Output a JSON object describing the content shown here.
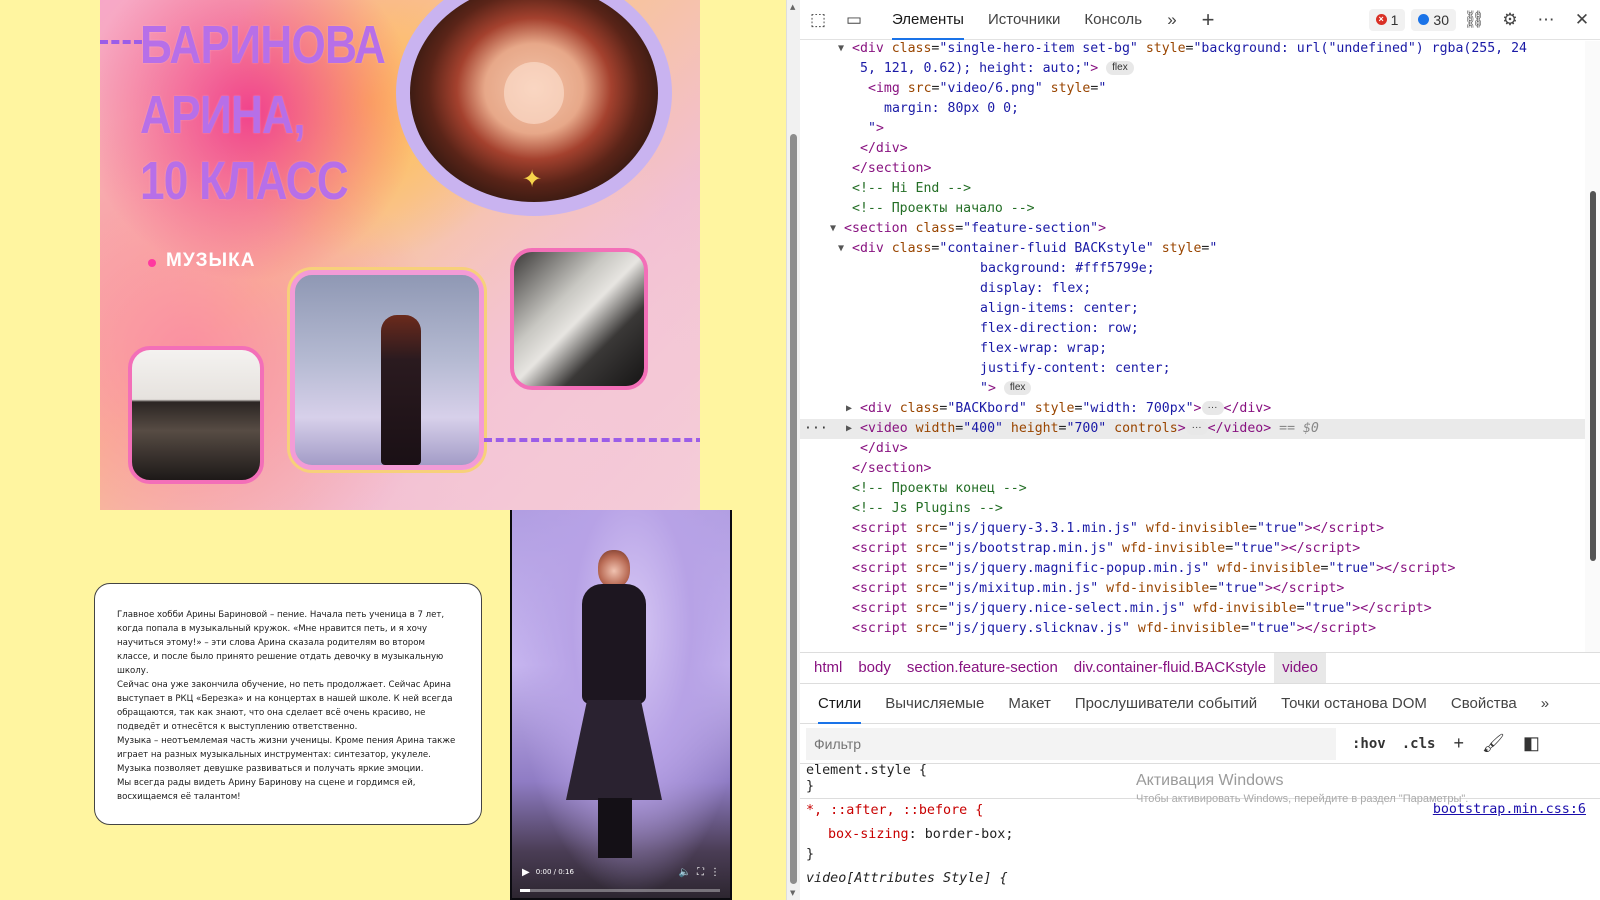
{
  "page": {
    "hero": {
      "name_lines": [
        "БАРИНОВА",
        "АРИНА,",
        "10 КЛАСС"
      ],
      "tag": "МУЗЫКА"
    },
    "bio": {
      "paragraphs": [
        "Главное хобби Арины Бариновой – пение. Начала петь ученица в 7 лет, когда попала в музыкальный кружок. «Мне нравится петь, и я хочу научиться этому!» – эти слова Арина сказала родителям во втором классе, и после было принято решение отдать девочку в музыкальную школу.",
        "Сейчас она уже закончила обучение, но петь продолжает. Сейчас Арина выступает в РКЦ «Березка» и на концертах в нашей школе. К ней всегда обращаются, так как знают, что она сделает всё очень красиво, не подведёт и отнесётся к выступлению ответственно.",
        "Музыка – неотъемлемая часть жизни ученицы. Кроме пения Арина также играет на разных музыкальных инструментах: синтезатор, укулеле. Музыка позволяет девушке развиваться и получать яркие эмоции.",
        "Мы всегда рады видеть Арину Баринову на сцене и гордимся ей, восхищаемся её талантом!"
      ]
    },
    "video": {
      "time": "0:00 / 0:16",
      "progress": 0.05,
      "play_icon": "play-icon",
      "volume_icon": "volume-icon",
      "fullscreen_icon": "fullscreen-icon",
      "more_icon": "more-vertical-icon"
    }
  },
  "devtools": {
    "tabs": [
      "Элементы",
      "Источники",
      "Консоль"
    ],
    "active_tab": "Элементы",
    "errors_count": "1",
    "messages_count": "30",
    "dom_lines": [
      {
        "indent": 4,
        "arrow": "▼",
        "html": "<span class='tg'>&lt;div</span> <span class='at'>class</span>=<span class='av'>\"single-hero-item set-bg\"</span> <span class='at'>style</span>=<span class='av'>\"background: url(\"undefined\") rgba(255, 24</span>"
      },
      {
        "indent": 5,
        "arrow": "",
        "html": "<span class='av'>5, 121, 0.62); height: auto;\"</span><span class='tg'>&gt;</span> <span class='pill'>flex</span>"
      },
      {
        "indent": 6,
        "arrow": "",
        "html": "<span class='tg'>&lt;img</span> <span class='at'>src</span>=<span class='av'>\"video/6.png\"</span> <span class='at'>style</span>=<span class='av'>\"</span>"
      },
      {
        "indent": 8,
        "arrow": "",
        "html": "<span class='av'>margin: 80px 0 0;</span>"
      },
      {
        "indent": 6,
        "arrow": "",
        "html": "<span class='av'>\"</span><span class='tg'>&gt;</span>"
      },
      {
        "indent": 5,
        "arrow": "",
        "html": "<span class='tg'>&lt;/div&gt;</span>"
      },
      {
        "indent": 4,
        "arrow": "",
        "html": "<span class='tg'>&lt;/section&gt;</span>"
      },
      {
        "indent": 4,
        "arrow": "",
        "html": "<span class='cm'>&lt;!-- Hi End --&gt;</span>"
      },
      {
        "indent": 4,
        "arrow": "",
        "html": "<span class='cm'>&lt;!-- Проекты начало --&gt;</span>"
      },
      {
        "indent": 3,
        "arrow": "▼",
        "html": "<span class='tg'>&lt;section</span> <span class='at'>class</span>=<span class='av'>\"feature-section\"</span><span class='tg'>&gt;</span>"
      },
      {
        "indent": 4,
        "arrow": "▼",
        "html": "<span class='tg'>&lt;div</span> <span class='at'>class</span>=<span class='av'>\"container-fluid BACKstyle\"</span> <span class='at'>style</span>=<span class='av'>\"</span>"
      },
      {
        "indent": 20,
        "arrow": "",
        "html": "<span class='av'>background: #fff5799e;</span>"
      },
      {
        "indent": 20,
        "arrow": "",
        "html": "<span class='av'>display: flex;</span>"
      },
      {
        "indent": 20,
        "arrow": "",
        "html": "<span class='av'>align-items: center;</span>"
      },
      {
        "indent": 20,
        "arrow": "",
        "html": "<span class='av'>flex-direction: row;</span>"
      },
      {
        "indent": 20,
        "arrow": "",
        "html": "<span class='av'>flex-wrap: wrap;</span>"
      },
      {
        "indent": 20,
        "arrow": "",
        "html": "<span class='av'>justify-content: center;</span>"
      },
      {
        "indent": 20,
        "arrow": "",
        "html": "<span class='av'>\"</span><span class='tg'>&gt;</span> <span class='pill'>flex</span>"
      },
      {
        "indent": 5,
        "arrow": "▶",
        "html": "<span class='tg'>&lt;div</span> <span class='at'>class</span>=<span class='av'>\"BACKbord\"</span> <span class='at'>style</span>=<span class='av'>\"width: 700px\"</span><span class='tg'>&gt;</span><span class='pill'>···</span><span class='tg'>&lt;/div&gt;</span>"
      },
      {
        "indent": 5,
        "arrow": "▶",
        "selected": true,
        "html": "<span class='tg'>&lt;video</span> <span class='at'>width</span>=<span class='av'>\"400\"</span> <span class='at'>height</span>=<span class='av'>\"700\"</span> <span class='at'>controls</span><span class='tg'>&gt;</span><span class='pill'>···</span><span class='tg'>&lt;/video&gt;</span> <span class='gray'>== $0</span>"
      },
      {
        "indent": 5,
        "arrow": "",
        "html": "<span class='tg'>&lt;/div&gt;</span>"
      },
      {
        "indent": 4,
        "arrow": "",
        "html": "<span class='tg'>&lt;/section&gt;</span>"
      },
      {
        "indent": 4,
        "arrow": "",
        "html": "<span class='cm'>&lt;!-- Проекты конец --&gt;</span>"
      },
      {
        "indent": 4,
        "arrow": "",
        "html": "<span class='cm'>&lt;!-- Js Plugins --&gt;</span>"
      },
      {
        "indent": 4,
        "arrow": "",
        "html": "<span class='tg'>&lt;script</span> <span class='at'>src</span>=<span class='av'>\"js/jquery-3.3.1.min.js\"</span> <span class='at'>wfd-invisible</span>=<span class='av'>\"true\"</span><span class='tg'>&gt;&lt;/script&gt;</span>"
      },
      {
        "indent": 4,
        "arrow": "",
        "html": "<span class='tg'>&lt;script</span> <span class='at'>src</span>=<span class='av'>\"js/bootstrap.min.js\"</span> <span class='at'>wfd-invisible</span>=<span class='av'>\"true\"</span><span class='tg'>&gt;&lt;/script&gt;</span>"
      },
      {
        "indent": 4,
        "arrow": "",
        "html": "<span class='tg'>&lt;script</span> <span class='at'>src</span>=<span class='av'>\"js/jquery.magnific-popup.min.js\"</span> <span class='at'>wfd-invisible</span>=<span class='av'>\"true\"</span><span class='tg'>&gt;&lt;/script&gt;</span>"
      },
      {
        "indent": 4,
        "arrow": "",
        "html": "<span class='tg'>&lt;script</span> <span class='at'>src</span>=<span class='av'>\"js/mixitup.min.js\"</span> <span class='at'>wfd-invisible</span>=<span class='av'>\"true\"</span><span class='tg'>&gt;&lt;/script&gt;</span>"
      },
      {
        "indent": 4,
        "arrow": "",
        "html": "<span class='tg'>&lt;script</span> <span class='at'>src</span>=<span class='av'>\"js/jquery.nice-select.min.js\"</span> <span class='at'>wfd-invisible</span>=<span class='av'>\"true\"</span><span class='tg'>&gt;&lt;/script&gt;</span>"
      },
      {
        "indent": 4,
        "arrow": "",
        "html": "<span class='tg'>&lt;script</span> <span class='at'>src</span>=<span class='av'>\"js/jquery.slicknav.js\"</span> <span class='at'>wfd-invisible</span>=<span class='av'>\"true\"</span><span class='tg'>&gt;&lt;/script&gt;</span>"
      }
    ],
    "breadcrumbs": [
      "html",
      "body",
      "section.feature-section",
      "div.container-fluid.BACKstyle",
      "video"
    ],
    "styles_tabs": [
      "Стили",
      "Вычисляемые",
      "Макет",
      "Прослушиватели событий",
      "Точки останова DOM",
      "Свойства"
    ],
    "filter_placeholder": "Фильтр",
    "hov_label": ":hov",
    "cls_label": ".cls",
    "styles": {
      "element_style_open": "element.style {",
      "close_brace": "}",
      "universal_selector": "*, ::after, ::before {",
      "rule_prop": "box-sizing",
      "rule_value": "border-box;",
      "source_link": "bootstrap.min.css:6",
      "next_rule": "video[Attributes Style] {"
    },
    "watermark": {
      "title": "Активация Windows",
      "subtitle": "Чтобы активировать Windows, перейдите в раздел \"Параметры\"."
    }
  }
}
